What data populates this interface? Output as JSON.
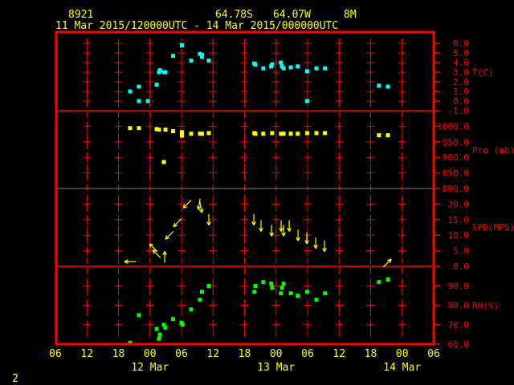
{
  "header": {
    "station": "8921",
    "lat": "64.78S",
    "lon": "64.07W",
    "elev": "8M",
    "period": "11 Mar 2015/120000UTC - 14 Mar 2015/000000UTC"
  },
  "page_number": "2",
  "colors": {
    "frame": "#ff0000",
    "axis_text": "#ff0000",
    "header_text": "#ffff00",
    "temperature": "#00ffff",
    "pressure": "#ffff00",
    "wind": "#ffff00",
    "humidity": "#00ff00",
    "divider_800": "#808080"
  },
  "chart_data": {
    "type": "scatter",
    "xlim": [
      "2015-03-11T06:00",
      "2015-03-14T06:00"
    ],
    "x_tick_labels": [
      "06",
      "12",
      "18",
      "00",
      "06",
      "12",
      "18",
      "00",
      "06",
      "12",
      "18",
      "00",
      "06"
    ],
    "date_labels": [
      {
        "label": "12 Mar",
        "at": "2015-03-12T00:00"
      },
      {
        "label": "13 Mar",
        "at": "2015-03-13T00:00"
      },
      {
        "label": "14 Mar",
        "at": "2015-03-14T00:00"
      }
    ],
    "grid": true,
    "panels": [
      {
        "id": "temperature",
        "unit_label": "T(C)",
        "ylim": [
          -1,
          6.5
        ],
        "ticks": [
          "6.0",
          "5.0",
          "4.0",
          "3.0",
          "2.0",
          "1.0",
          "0.0",
          "-1.0"
        ],
        "marker": "square",
        "points": [
          [
            "2015-03-11T20:13",
            1.0
          ],
          [
            "2015-03-11T21:54",
            1.5
          ],
          [
            "2015-03-11T21:54",
            0.0
          ],
          [
            "2015-03-11T23:35",
            0.0
          ],
          [
            "2015-03-12T01:16",
            1.7
          ],
          [
            "2015-03-12T01:43",
            3.0
          ],
          [
            "2015-03-12T01:53",
            3.2
          ],
          [
            "2015-03-12T02:38",
            3.0
          ],
          [
            "2015-03-12T02:57",
            3.0
          ],
          [
            "2015-03-12T04:24",
            4.7
          ],
          [
            "2015-03-12T06:05",
            5.8
          ],
          [
            "2015-03-12T07:50",
            4.2
          ],
          [
            "2015-03-12T09:31",
            4.9
          ],
          [
            "2015-03-12T09:54",
            4.8
          ],
          [
            "2015-03-12T09:54",
            4.6
          ],
          [
            "2015-03-12T11:12",
            4.2
          ],
          [
            "2015-03-12T19:52",
            3.9
          ],
          [
            "2015-03-12T20:04",
            3.8
          ],
          [
            "2015-03-12T21:34",
            3.4
          ],
          [
            "2015-03-12T23:04",
            3.6
          ],
          [
            "2015-03-12T23:15",
            3.8
          ],
          [
            "2015-03-13T00:56",
            4.0
          ],
          [
            "2015-03-13T01:07",
            3.6
          ],
          [
            "2015-03-13T01:26",
            3.4
          ],
          [
            "2015-03-13T02:48",
            3.5
          ],
          [
            "2015-03-13T04:07",
            3.6
          ],
          [
            "2015-03-13T05:55",
            3.1
          ],
          [
            "2015-03-13T05:55",
            0.0
          ],
          [
            "2015-03-13T07:41",
            3.4
          ],
          [
            "2015-03-13T09:18",
            3.4
          ],
          [
            "2015-03-13T19:35",
            1.6
          ],
          [
            "2015-03-13T21:17",
            1.5
          ]
        ]
      },
      {
        "id": "pressure",
        "unit_label": "Pre (mb)",
        "ylim": [
          800,
          1050
        ],
        "ticks": [
          "1000.0",
          "950.0",
          "900.0",
          "850.0",
          "800.0"
        ],
        "marker": "square",
        "points": [
          [
            "2015-03-11T20:13",
            994
          ],
          [
            "2015-03-11T21:54",
            994
          ],
          [
            "2015-03-12T01:16",
            991
          ],
          [
            "2015-03-12T01:43",
            989
          ],
          [
            "2015-03-12T02:57",
            989
          ],
          [
            "2015-03-12T02:38",
            885
          ],
          [
            "2015-03-12T04:24",
            984
          ],
          [
            "2015-03-12T06:05",
            981
          ],
          [
            "2015-03-12T06:05",
            970
          ],
          [
            "2015-03-12T07:50",
            976
          ],
          [
            "2015-03-12T09:31",
            976
          ],
          [
            "2015-03-12T09:54",
            976
          ],
          [
            "2015-03-12T11:12",
            978
          ],
          [
            "2015-03-12T19:52",
            978
          ],
          [
            "2015-03-12T20:04",
            976
          ],
          [
            "2015-03-12T21:34",
            976
          ],
          [
            "2015-03-12T23:15",
            978
          ],
          [
            "2015-03-13T00:56",
            976
          ],
          [
            "2015-03-13T01:26",
            976
          ],
          [
            "2015-03-13T02:48",
            976
          ],
          [
            "2015-03-13T04:07",
            976
          ],
          [
            "2015-03-13T05:55",
            978
          ],
          [
            "2015-03-13T07:41",
            978
          ],
          [
            "2015-03-13T09:18",
            978
          ],
          [
            "2015-03-13T19:35",
            971
          ],
          [
            "2015-03-13T21:17",
            971
          ]
        ]
      },
      {
        "id": "wind",
        "unit_label": "SPD(MPS)",
        "ylim": [
          0,
          25
        ],
        "ticks": [
          "20.0",
          "15.0",
          "10.0",
          "5.0",
          "0.0"
        ],
        "marker": "arrow",
        "points": [
          [
            "2015-03-11T20:13",
            1.5,
            270
          ],
          [
            "2015-03-12T00:39",
            6,
            315
          ],
          [
            "2015-03-12T01:16",
            4,
            315
          ],
          [
            "2015-03-12T02:48",
            3,
            0
          ],
          [
            "2015-03-12T03:43",
            10,
            225
          ],
          [
            "2015-03-12T05:14",
            14,
            225
          ],
          [
            "2015-03-12T07:05",
            20,
            225
          ],
          [
            "2015-03-12T09:22",
            20,
            190
          ],
          [
            "2015-03-12T09:41",
            19,
            170
          ],
          [
            "2015-03-12T11:12",
            15,
            180
          ],
          [
            "2015-03-12T19:46",
            15,
            180
          ],
          [
            "2015-03-12T21:08",
            13,
            180
          ],
          [
            "2015-03-12T23:08",
            11.5,
            180
          ],
          [
            "2015-03-13T00:58",
            13,
            180
          ],
          [
            "2015-03-13T01:26",
            11.5,
            180
          ],
          [
            "2015-03-13T02:30",
            13,
            180
          ],
          [
            "2015-03-13T04:11",
            10,
            180
          ],
          [
            "2015-03-13T05:51",
            9,
            180
          ],
          [
            "2015-03-13T07:32",
            7.5,
            180
          ],
          [
            "2015-03-13T09:13",
            6.5,
            180
          ],
          [
            "2015-03-13T21:09",
            1,
            45
          ]
        ]
      },
      {
        "id": "humidity",
        "unit_label": "RH(%)",
        "ylim": [
          60,
          100
        ],
        "ticks": [
          "90.0",
          "80.0",
          "70.0",
          "60.0"
        ],
        "marker": "square",
        "points": [
          [
            "2015-03-11T20:13",
            60.7
          ],
          [
            "2015-03-11T21:54",
            74.9
          ],
          [
            "2015-03-12T01:16",
            67.8
          ],
          [
            "2015-03-12T01:53",
            64.9
          ],
          [
            "2015-03-12T01:43",
            62.8
          ],
          [
            "2015-03-12T02:38",
            69.9
          ],
          [
            "2015-03-12T02:57",
            68.5
          ],
          [
            "2015-03-12T04:24",
            72.9
          ],
          [
            "2015-03-12T06:00",
            71.0
          ],
          [
            "2015-03-12T06:12",
            70.0
          ],
          [
            "2015-03-12T07:50",
            77.8
          ],
          [
            "2015-03-12T09:31",
            82.8
          ],
          [
            "2015-03-12T09:54",
            86.9
          ],
          [
            "2015-03-12T11:12",
            89.9
          ],
          [
            "2015-03-12T19:52",
            86.9
          ],
          [
            "2015-03-12T20:04",
            89.9
          ],
          [
            "2015-03-12T21:34",
            91.9
          ],
          [
            "2015-03-12T23:04",
            91.1
          ],
          [
            "2015-03-12T23:15",
            89.0
          ],
          [
            "2015-03-13T00:56",
            86.1
          ],
          [
            "2015-03-13T01:07",
            89.0
          ],
          [
            "2015-03-13T01:26",
            91.1
          ],
          [
            "2015-03-13T02:48",
            86.1
          ],
          [
            "2015-03-13T04:07",
            84.9
          ],
          [
            "2015-03-13T05:55",
            86.9
          ],
          [
            "2015-03-13T07:41",
            82.8
          ],
          [
            "2015-03-13T09:18",
            86.1
          ],
          [
            "2015-03-13T19:35",
            91.9
          ],
          [
            "2015-03-13T21:17",
            93.2
          ]
        ]
      }
    ]
  }
}
